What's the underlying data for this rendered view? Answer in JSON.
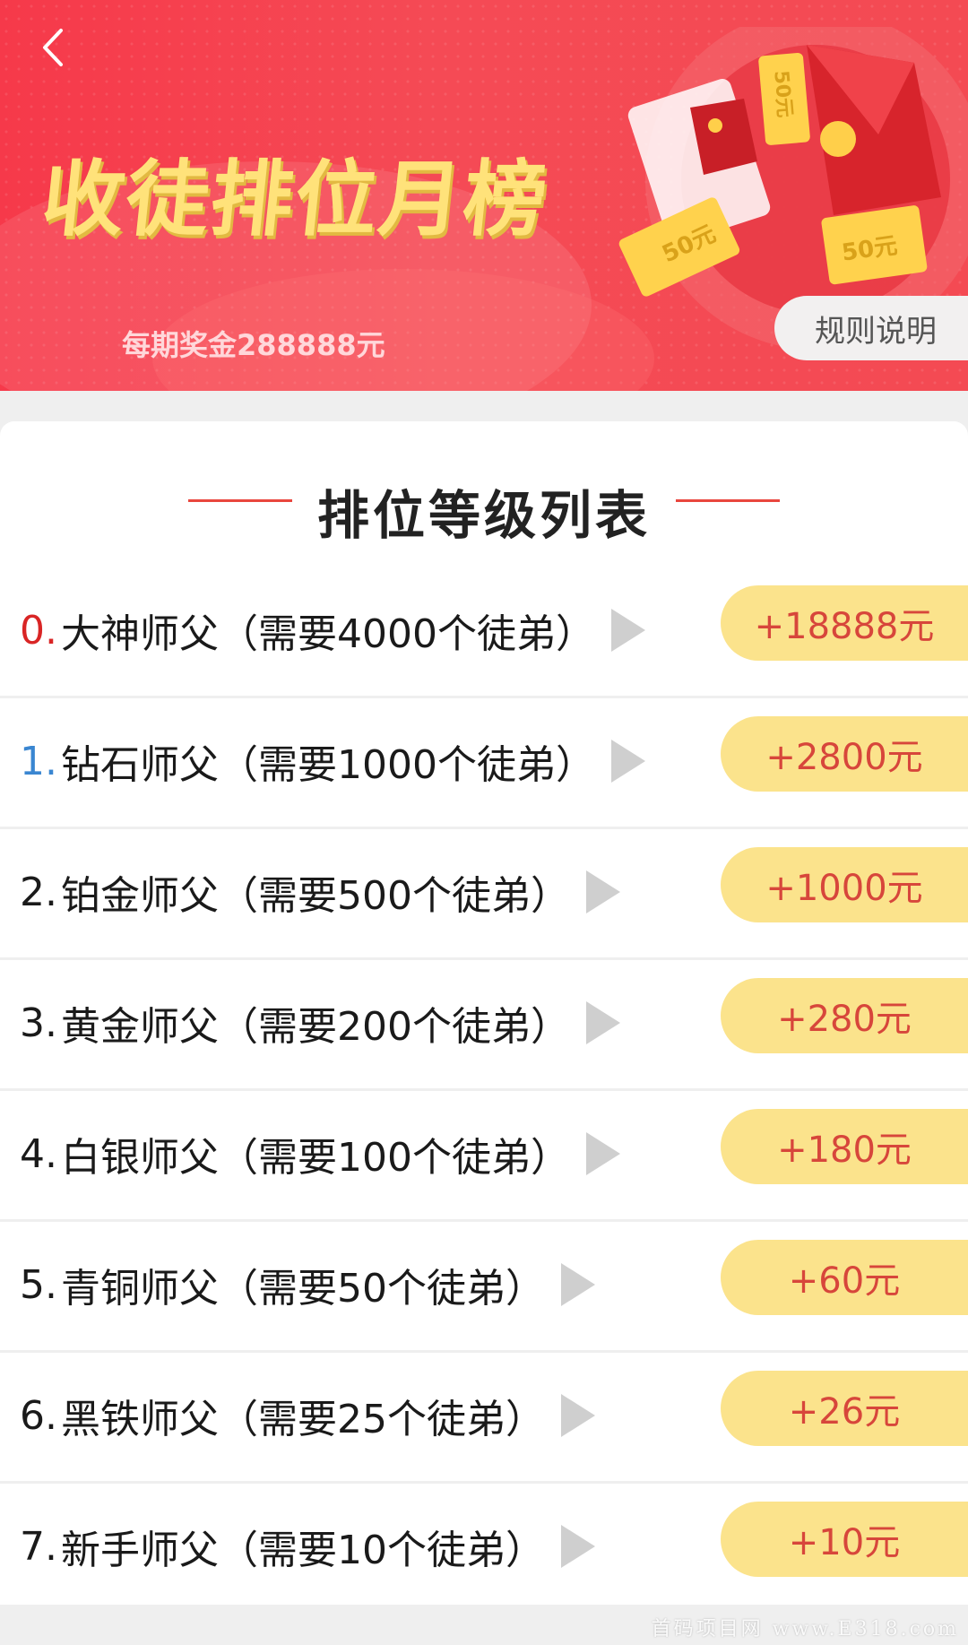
{
  "banner": {
    "title": "收徒排位月榜",
    "prize_text": "每期奖金288888元",
    "rules_button": "规则说明",
    "ticket_labels": [
      "50元",
      "50元",
      "50元"
    ]
  },
  "section": {
    "title": "排位等级列表"
  },
  "rows": [
    {
      "num": "0.",
      "num_color": "#d92525",
      "text": "大神师父（需要4000个徒弟）",
      "reward": "+18888元"
    },
    {
      "num": "1.",
      "num_color": "#3a86d1",
      "text": "钻石师父（需要1000个徒弟）",
      "reward": "+2800元"
    },
    {
      "num": "2.",
      "num_color": "#1a1a1a",
      "text": "铂金师父（需要500个徒弟）",
      "reward": "+1000元"
    },
    {
      "num": "3.",
      "num_color": "#1a1a1a",
      "text": "黄金师父（需要200个徒弟）",
      "reward": "+280元"
    },
    {
      "num": "4.",
      "num_color": "#1a1a1a",
      "text": "白银师父（需要100个徒弟）",
      "reward": "+180元"
    },
    {
      "num": "5.",
      "num_color": "#1a1a1a",
      "text": "青铜师父（需要50个徒弟）",
      "reward": "+60元"
    },
    {
      "num": "6.",
      "num_color": "#1a1a1a",
      "text": "黑铁师父（需要25个徒弟）",
      "reward": "+26元"
    },
    {
      "num": "7.",
      "num_color": "#1a1a1a",
      "text": "新手师父（需要10个徒弟）",
      "reward": "+10元"
    }
  ],
  "watermark": "首码项目网 www.E318.com",
  "icons": {
    "back": "chevron-left-icon",
    "row_arrow": "triangle-right-icon"
  },
  "colors": {
    "banner_red": "#f54a55",
    "title_gold": "#ffe27a",
    "reward_bg": "#fbe38c",
    "reward_text": "#d7463b",
    "divider_red": "#e9463e"
  }
}
